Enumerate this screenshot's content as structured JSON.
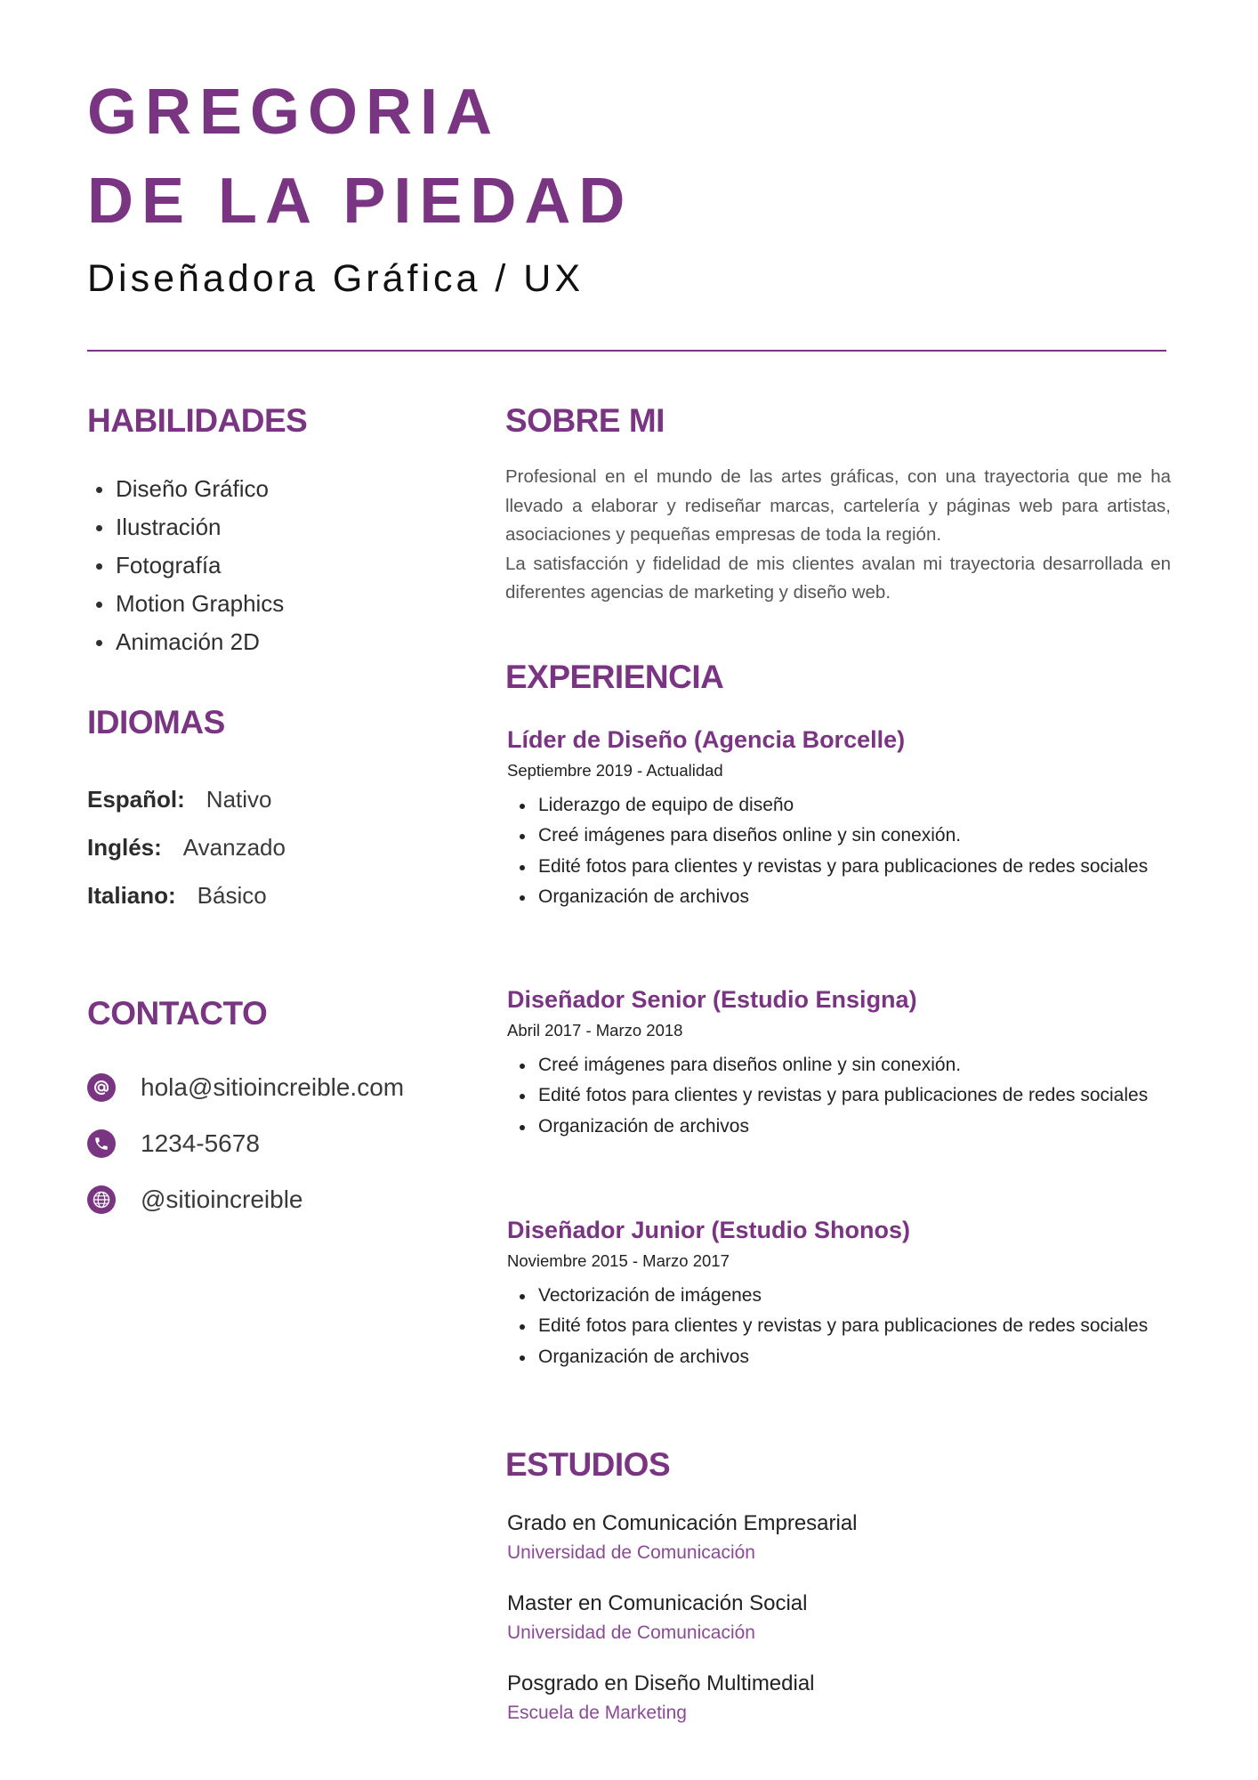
{
  "header": {
    "first_name": "GREGORIA",
    "last_name": "DE LA PIEDAD",
    "job_title": "Diseñadora Gráfica / UX"
  },
  "skills": {
    "title": "HABILIDADES",
    "items": [
      "Diseño Gráfico",
      "Ilustración",
      "Fotografía",
      "Motion Graphics",
      "Animación 2D"
    ]
  },
  "languages": {
    "title": "IDIOMAS",
    "items": [
      {
        "label": "Español:",
        "level": "Nativo"
      },
      {
        "label": "Inglés:",
        "level": "Avanzado"
      },
      {
        "label": "Italiano:",
        "level": "Básico"
      }
    ]
  },
  "contact": {
    "title": "CONTACTO",
    "items": [
      {
        "icon": "at-icon",
        "text": "hola@sitioincreible.com"
      },
      {
        "icon": "phone-icon",
        "text": "1234-5678"
      },
      {
        "icon": "globe-icon",
        "text": "@sitioincreible"
      }
    ]
  },
  "about": {
    "title": "SOBRE MI",
    "paragraphs": [
      "Profesional en el mundo de las artes gráficas, con una trayectoria que me ha llevado a elaborar y rediseñar marcas, cartelería y páginas web para artistas, asociaciones y pequeñas empresas de toda la región.",
      "La satisfacción y fidelidad de mis clientes avalan mi trayectoria desarrollada en diferentes agencias de marketing y diseño web."
    ]
  },
  "experience": {
    "title": "EXPERIENCIA",
    "jobs": [
      {
        "role": "Líder de Diseño (Agencia Borcelle)",
        "dates": "Septiembre 2019 - Actualidad",
        "tasks": [
          "Liderazgo de equipo de diseño",
          "Creé imágenes para diseños online y sin conexión.",
          "Edité fotos para clientes y revistas y para publicaciones de redes sociales",
          "Organización de archivos"
        ]
      },
      {
        "role": "Diseñador Senior (Estudio Ensigna)",
        "dates": "Abril 2017 - Marzo 2018",
        "tasks": [
          "Creé imágenes para diseños online y sin conexión.",
          "Edité fotos para clientes y revistas y para publicaciones de redes sociales",
          "Organización de archivos"
        ]
      },
      {
        "role": "Diseñador Junior (Estudio Shonos)",
        "dates": "Noviembre 2015 - Marzo 2017",
        "tasks": [
          "Vectorización de imágenes",
          "Edité fotos para clientes y revistas y para publicaciones de redes sociales",
          "Organización de archivos"
        ]
      }
    ]
  },
  "education": {
    "title": "ESTUDIOS",
    "items": [
      {
        "degree": "Grado en Comunicación Empresarial",
        "school": "Universidad de Comunicación"
      },
      {
        "degree": "Master en Comunicación Social",
        "school": "Universidad de Comunicación"
      },
      {
        "degree": "Posgrado en Diseño Multimedial",
        "school": "Escuela de Marketing"
      }
    ]
  },
  "colors": {
    "accent": "#7a3582",
    "school_text": "#8c4a96"
  }
}
